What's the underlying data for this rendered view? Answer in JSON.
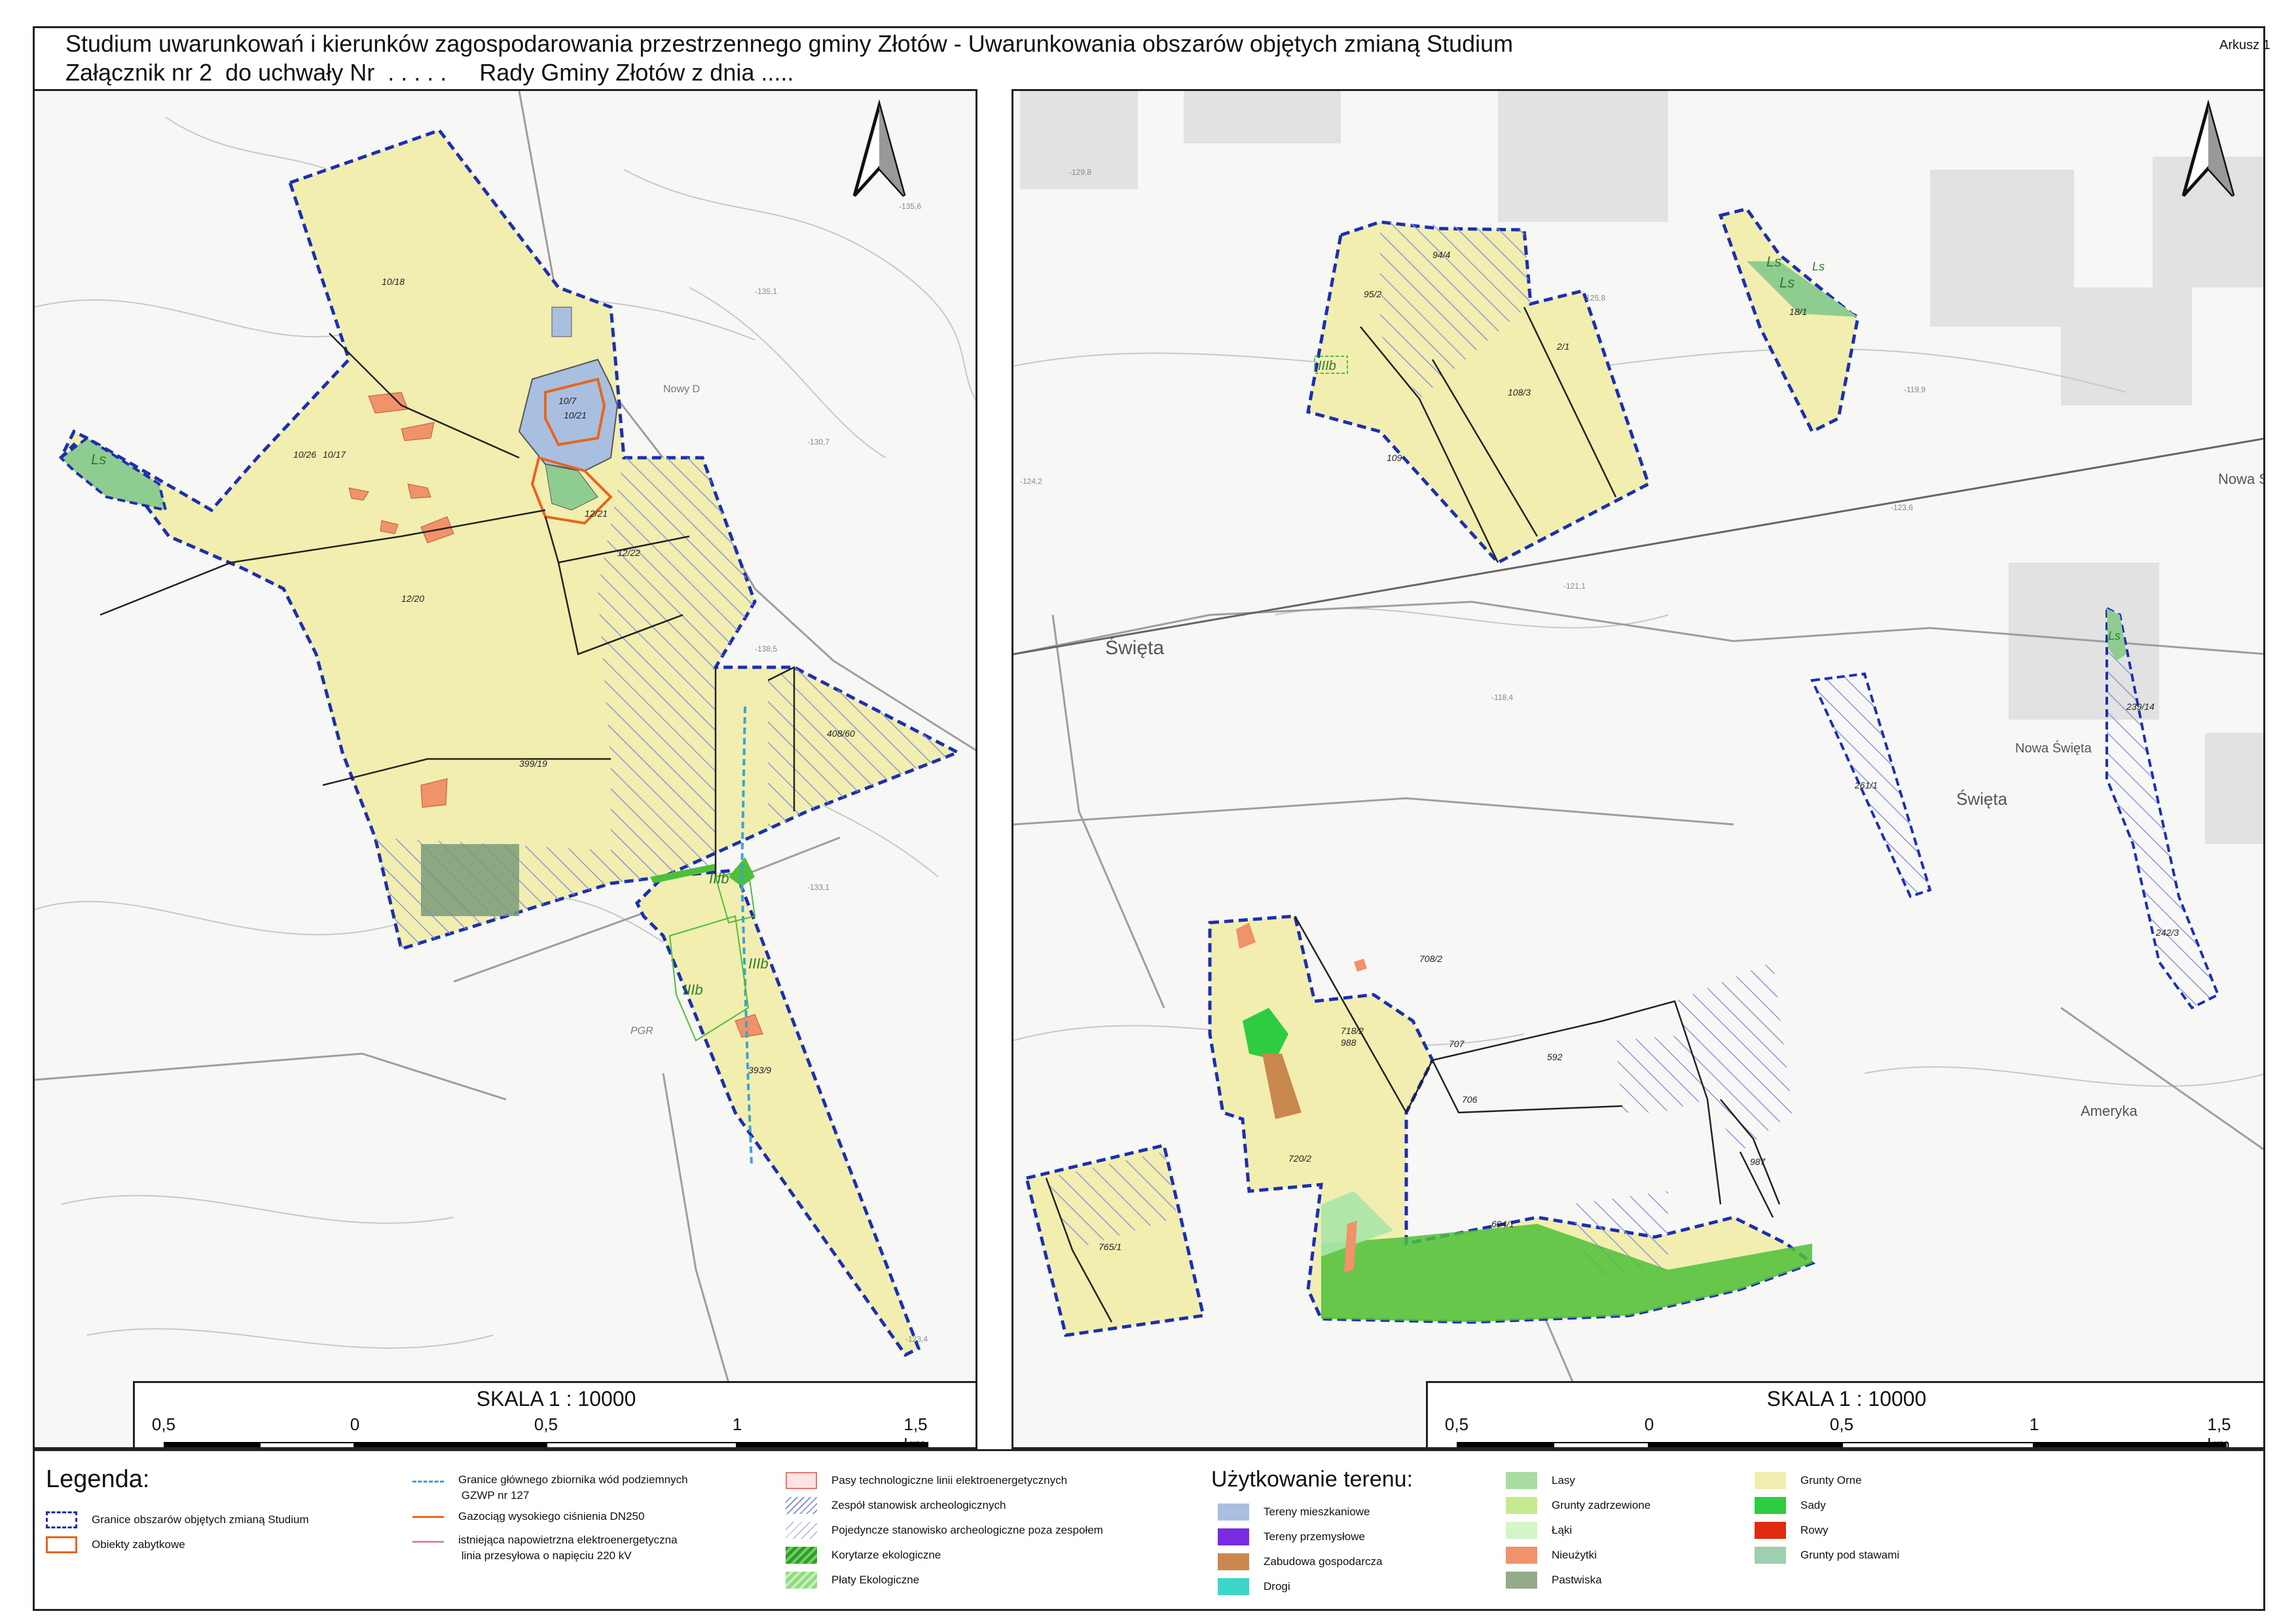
{
  "header": {
    "title_line1": "Studium uwarunkowań i kierunków zagospodarowania przestrzennego gminy Złotów - Uwarunkowania obszarów objętych zmianą Studium",
    "title_line2": "Załącznik nr 2  do uchwały Nr  . . . . .     Rady Gminy Złotów z dnia .....",
    "sheet": "Arkusz 1"
  },
  "colors": {
    "boundary": "#1c2fb0",
    "arable": "#f1eeb0",
    "residential": "#a9bfe0",
    "wasteland": "#f0926a",
    "forest": "#8fcc8f",
    "heritage": "#e8651e",
    "ecological": "#4dbf3a",
    "hatch": "#8d96d6",
    "orchard": "#2ecc40",
    "farm": "#c9884e",
    "pasture": "#7a9a7a"
  },
  "left_map": {
    "scale_title": "SKALA 1 : 10000",
    "scale_ticks": [
      "0,5",
      "0",
      "0,5",
      "1",
      "1,5 km"
    ],
    "parcels": [
      "10/18",
      "10/26",
      "10/17",
      "12/20",
      "12/21",
      "12/22",
      "10/7",
      "10/21",
      "399/19",
      "408/60",
      "393/9"
    ],
    "symbols": [
      "Ls",
      "IIIb",
      "IIIb",
      "IIIb"
    ],
    "places": [
      "Nowy D",
      "PGR"
    ],
    "spot_heights": [
      "-135,6",
      "-135,1",
      "-130,7",
      "-138,5",
      "-133,1",
      "-123,4"
    ]
  },
  "right_map": {
    "scale_title": "SKALA 1 : 10000",
    "scale_ticks": [
      "0,5",
      "0",
      "0,5",
      "1",
      "1,5 km"
    ],
    "parcels": [
      "94/4",
      "95/2",
      "2/1",
      "108/3",
      "109",
      "18/1",
      "239/14",
      "261/1",
      "242/3",
      "708/2",
      "718/2",
      "988",
      "707",
      "592",
      "706",
      "720/2",
      "694/1",
      "987",
      "765/1"
    ],
    "symbols": [
      "IIIb",
      "Ls",
      "Ls",
      "Ls",
      "Ls"
    ],
    "places": [
      "Święta",
      "Nowa Święta",
      "Święta",
      "Nowa Sw",
      "Ameryka"
    ],
    "spot_heights": [
      "-129,8",
      "-125,8",
      "-124,2",
      "-121,1",
      "-118,4",
      "-123,6",
      "-119,9"
    ]
  },
  "legend": {
    "title": "Legenda:",
    "landuse_title": "Użytkowanie terenu:",
    "items": [
      {
        "label": "Granice obszarów objętych zmianą Studium"
      },
      {
        "label": "Obiekty zabytkowe"
      },
      {
        "label": "Granice głównego zbiornika wód podziemnych\n GZWP nr 127"
      },
      {
        "label": "Gazociąg wysokiego ciśnienia DN250"
      },
      {
        "label": "istniejąca napowietrzna elektroenergetyczna\n linia przesyłowa o napięciu 220 kV"
      },
      {
        "label": "Pasy technologiczne linii elektroenergetycznych"
      },
      {
        "label": "Zespół stanowisk archeologicznych"
      },
      {
        "label": "Pojedyncze stanowisko archeologiczne poza zespołem"
      },
      {
        "label": "Korytarze ekologiczne"
      },
      {
        "label": "Płaty Ekologiczne"
      },
      {
        "label": "Tereny mieszkaniowe"
      },
      {
        "label": "Tereny przemysłowe"
      },
      {
        "label": "Zabudowa gospodarcza"
      },
      {
        "label": "Drogi"
      },
      {
        "label": "Lasy"
      },
      {
        "label": "Grunty zadrzewione"
      },
      {
        "label": "Łąki"
      },
      {
        "label": "Nieużytki"
      },
      {
        "label": "Pastwiska"
      },
      {
        "label": "Grunty Orne"
      },
      {
        "label": "Sady"
      },
      {
        "label": "Rowy"
      },
      {
        "label": "Grunty pod stawami"
      }
    ]
  }
}
